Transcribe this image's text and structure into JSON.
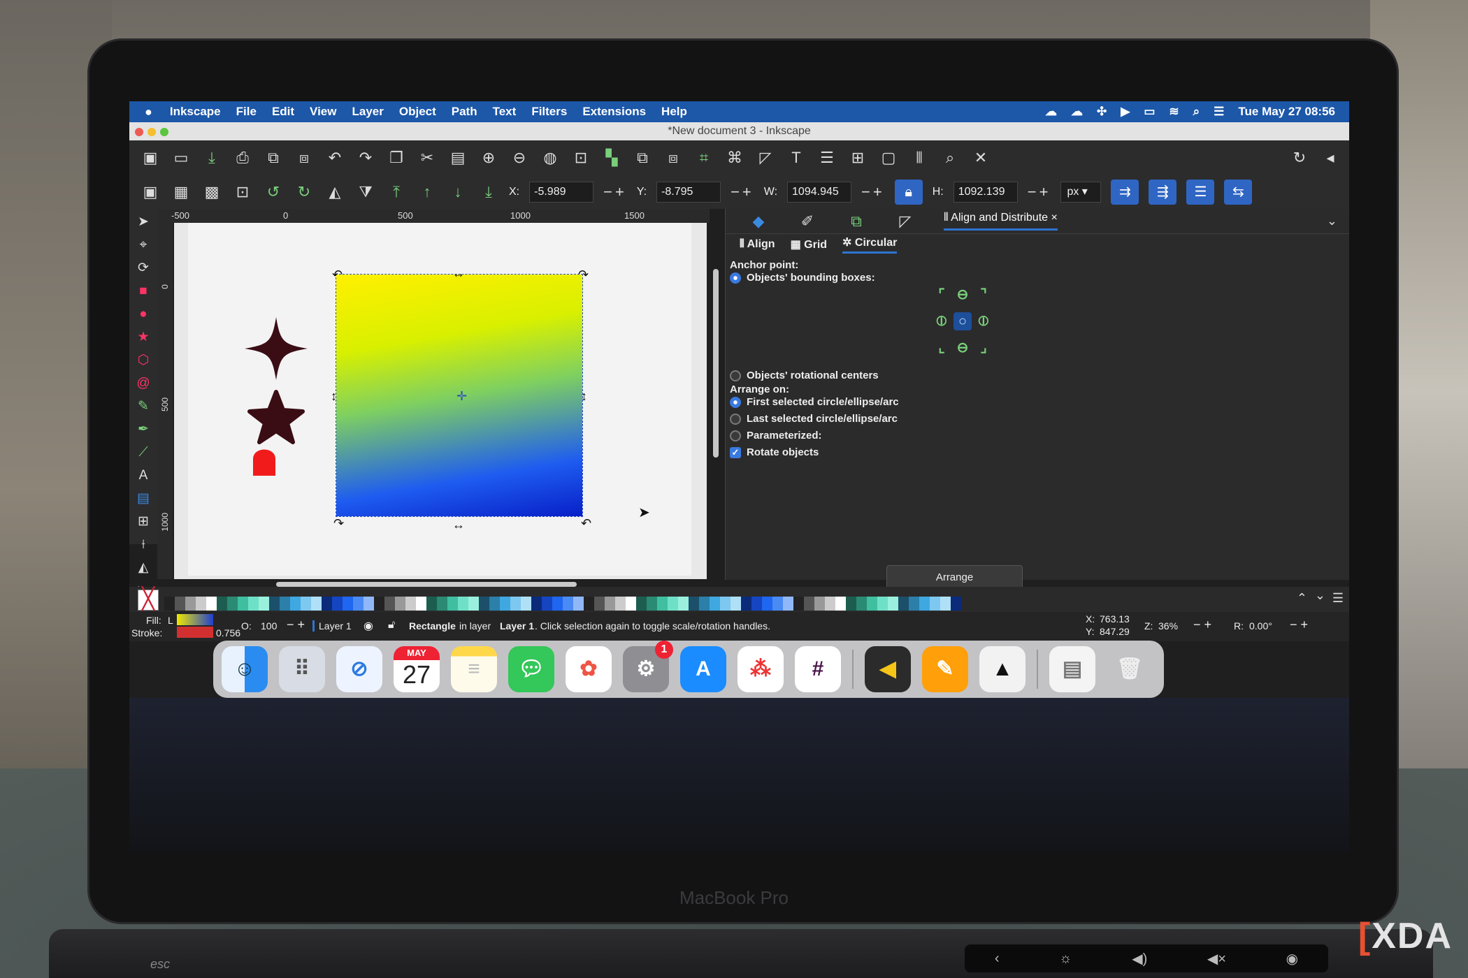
{
  "menubar": {
    "apple": "",
    "app": "Inkscape",
    "items": [
      "File",
      "Edit",
      "View",
      "Layer",
      "Object",
      "Path",
      "Text",
      "Filters",
      "Extensions",
      "Help"
    ],
    "clock": "Tue May 27  08:56"
  },
  "window": {
    "title": "*New document 3 - Inkscape"
  },
  "toolbar2": {
    "x_label": "X:",
    "x_value": "-5.989",
    "y_label": "Y:",
    "y_value": "-8.795",
    "w_label": "W:",
    "w_value": "1094.945",
    "h_label": "H:",
    "h_value": "1092.139",
    "unit": "px"
  },
  "ruler": {
    "h_ticks": [
      "-500",
      "0",
      "500",
      "1000",
      "1500"
    ],
    "v_ticks": [
      "0",
      "500",
      "1000"
    ]
  },
  "dialog": {
    "tab_active": "Align and Distribute",
    "subtabs": [
      "Align",
      "Grid",
      "Circular"
    ],
    "anchor_title": "Anchor point:",
    "opt_bbox": "Objects' bounding boxes:",
    "opt_centers": "Objects' rotational centers",
    "arrange_on": "Arrange on:",
    "opt_first": "First selected circle/ellipse/arc",
    "opt_last": "Last selected circle/ellipse/arc",
    "opt_param": "Parameterized:",
    "opt_rotate": "Rotate objects",
    "arrange_button": "Arrange"
  },
  "status": {
    "fill_label": "Fill:",
    "fill_value": "L",
    "stroke_label": "Stroke:",
    "stroke_width": "0.756",
    "opacity_label": "O:",
    "opacity_value": "100",
    "layer": "Layer 1",
    "message_bold": "Rectangle",
    "message_mid": "in layer",
    "message_layer": "Layer 1",
    "message_rest": ". Click selection again to toggle scale/rotation handles.",
    "cursor_x_label": "X:",
    "cursor_x": "763.13",
    "cursor_y_label": "Y:",
    "cursor_y": "847.29",
    "zoom_label": "Z:",
    "zoom": "36%",
    "rotate_label": "R:",
    "rotate": "0.00°"
  },
  "dock": {
    "calendar_month": "MAY",
    "calendar_day": "27",
    "settings_badge": "1"
  },
  "device": {
    "brand": "MacBook Pro",
    "esc": "esc"
  },
  "watermark": {
    "logo": "XDA"
  },
  "colors": {
    "accent": "#2f74d0",
    "menubar": "#1c57a8",
    "gradient_top": "#fff000",
    "gradient_bottom": "#0820c8",
    "shape_dark": "#3a0d14",
    "shape_red": "#f21b1b"
  }
}
